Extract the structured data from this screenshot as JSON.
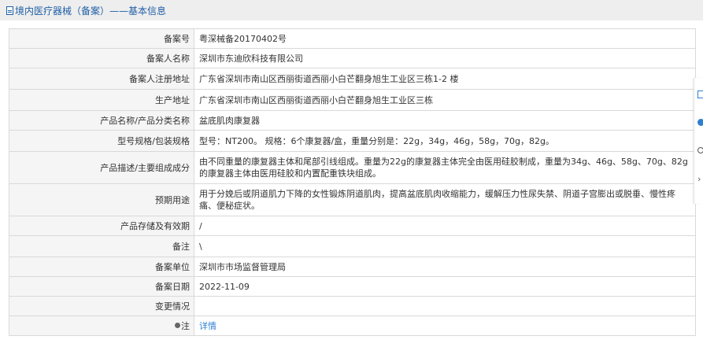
{
  "header": {
    "title": "境内医疗器械（备案）——基本信息"
  },
  "rows": [
    {
      "label": "备案号",
      "value": "粤深械备20170402号"
    },
    {
      "label": "备案人名称",
      "value": "深圳市东迪欣科技有限公司"
    },
    {
      "label": "备案人注册地址",
      "value": "广东省深圳市南山区西丽街道西丽小白芒翻身旭生工业区三栋1-2 楼"
    },
    {
      "label": "生产地址",
      "value": "广东省深圳市南山区西丽街道西丽小白芒翻身旭生工业区三栋"
    },
    {
      "label": "产品名称/产品分类名称",
      "value": "盆底肌肉康复器"
    },
    {
      "label": "型号规格/包装规格",
      "value": "型号：NT200。 规格：6个康复器/盒，重量分别是：22g，34g，46g，58g，70g，82g。"
    },
    {
      "label": "产品描述/主要组成成分",
      "value": "由不同重量的康复器主体和尾部引线组成。重量为22g的康复器主体完全由医用硅胶制成，重量为34g、46g、58g、70g、82g的康复器主体由医用硅胶和内置配重铁块组成。"
    },
    {
      "label": "预期用途",
      "value": "用于分娩后或阴道肌力下降的女性锻炼阴道肌肉，提高盆底肌肉收缩能力，缓解压力性尿失禁、阴道子宫膨出或脱垂、慢性疼痛、便秘症状。"
    },
    {
      "label": "产品存储及有效期",
      "value": "/"
    },
    {
      "label": "备注",
      "value": "\\"
    },
    {
      "label": "备案单位",
      "value": "深圳市市场监督管理局"
    },
    {
      "label": "备案日期",
      "value": "2022-11-09"
    },
    {
      "label": "变更情况",
      "value": ""
    }
  ],
  "note_row": {
    "label": "注",
    "icon": "pin-icon",
    "link": "详情"
  },
  "side_toolbar": {
    "icons": [
      "document-icon",
      "circle-icon",
      "search-icon",
      "chevron-right-icon"
    ],
    "accent": "#2d7fd0"
  },
  "colors": {
    "title_text": "#1f5fa6",
    "title_bar_bg": "#eeeeee",
    "label_bg": "#f5f5f5",
    "border": "#d9d9d9",
    "link": "#2d7fd0"
  }
}
